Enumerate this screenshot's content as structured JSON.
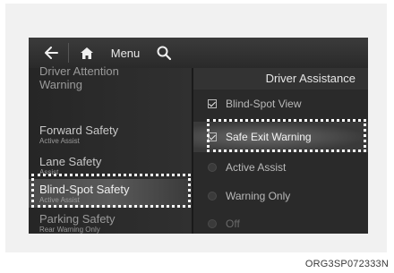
{
  "topbar": {
    "back_icon": "arrow-left-icon",
    "home_icon": "home-icon",
    "menu_label": "Menu",
    "search_icon": "search-icon"
  },
  "right_pane": {
    "title": "Driver Assistance",
    "options": [
      {
        "label": "Blind-Spot View",
        "control": "checkbox",
        "checked": true
      },
      {
        "label": "Safe Exit Warning",
        "control": "checkbox",
        "checked": true
      },
      {
        "label": "Active Assist",
        "control": "radio",
        "checked": false
      },
      {
        "label": "Warning Only",
        "control": "radio",
        "checked": false
      },
      {
        "label": "Off",
        "control": "radio",
        "checked": false
      }
    ]
  },
  "left_pane": {
    "items": [
      {
        "title": "Driver Attention Warning",
        "subtitle": ""
      },
      {
        "title": "Forward Safety",
        "subtitle": "Active Assist"
      },
      {
        "title": "Lane Safety",
        "subtitle": "Assist"
      },
      {
        "title": "Blind-Spot Safety",
        "subtitle": "Active Assist"
      },
      {
        "title": "Parking Safety",
        "subtitle": "Rear Warning Only"
      }
    ]
  },
  "caption": "ORG3SP072333N",
  "colors": {
    "highlight_border": "#ffffff",
    "screen_bg": "#1a1a1a"
  }
}
